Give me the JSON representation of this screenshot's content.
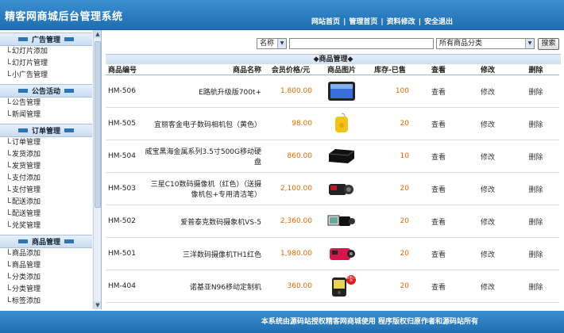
{
  "app": {
    "title": "精客网商城后台管理系统"
  },
  "topnav": {
    "links": [
      "网站首页",
      "管理首页",
      "资料修改",
      "安全退出"
    ],
    "separator": "|"
  },
  "sidebar": {
    "groups": [
      {
        "title": "广告管理",
        "items": [
          "幻灯片添加",
          "幻灯片管理",
          "小广告管理"
        ]
      },
      {
        "title": "公告活动",
        "items": [
          "公告管理",
          "新闻管理"
        ]
      },
      {
        "title": "订单管理",
        "items": [
          "订单管理",
          "发货添加",
          "发货管理",
          "支付添加",
          "支付管理",
          "配送添加",
          "配送管理",
          "兑奖管理"
        ]
      },
      {
        "title": "商品管理",
        "items": [
          "商品添加",
          "商品管理",
          "分类添加",
          "分类管理",
          "标签添加"
        ]
      }
    ]
  },
  "search": {
    "field_select": "名称",
    "query": "",
    "category_select": "所有商品分类",
    "button_label": "搜索"
  },
  "panel": {
    "title": "◆商品管理◆"
  },
  "table": {
    "headers": [
      "商品编号",
      "商品名称",
      "会员价格/元",
      "商品图片",
      "库存-已售",
      "查看",
      "修改",
      "删除"
    ],
    "rows": [
      {
        "code": "HM-506",
        "name": "E路航升级版700t+",
        "price": "1,800.00",
        "stock": "100",
        "view": "查看",
        "edit": "修改",
        "delete": "删除",
        "img_icon": "gps-device-image"
      },
      {
        "code": "HM-505",
        "name": "宜丽客金电子数码相机包（黄色）",
        "price": "98.00",
        "stock": "20",
        "view": "查看",
        "edit": "修改",
        "delete": "删除",
        "img_icon": "camera-bag-image"
      },
      {
        "code": "HM-504",
        "name": "威宝黑海金属系列3.5寸500G移动硬盘",
        "price": "860.00",
        "stock": "10",
        "view": "查看",
        "edit": "修改",
        "delete": "删除",
        "img_icon": "hard-drive-image"
      },
      {
        "code": "HM-503",
        "name": "三星C10数码摄像机（红色）（送摄像机包+专用清洁笔）",
        "price": "2,100.00",
        "stock": "20",
        "view": "查看",
        "edit": "修改",
        "delete": "删除",
        "img_icon": "camcorder-red-image"
      },
      {
        "code": "HM-502",
        "name": "爱普泰克数码摄象机VS-5",
        "price": "2,360.00",
        "stock": "20",
        "view": "查看",
        "edit": "修改",
        "delete": "删除",
        "img_icon": "camcorder-black-image"
      },
      {
        "code": "HM-501",
        "name": "三洋数码摄像机TH1红色",
        "price": "1,980.00",
        "stock": "20",
        "view": "查看",
        "edit": "修改",
        "delete": "删除",
        "img_icon": "camcorder-pink-image"
      },
      {
        "code": "HM-404",
        "name": "诺基亚N96移动定制机",
        "price": "360.00",
        "stock": "20",
        "view": "查看",
        "edit": "修改",
        "delete": "删除",
        "img_icon": "phone-image",
        "badge": "全新上市"
      }
    ]
  },
  "footer": {
    "text": "本系统由源码站授权精客网商城使用  程序版权归原作者和源码站所有"
  },
  "colors": {
    "header_blue": "#1f6db2",
    "price_orange": "#e06a00"
  }
}
